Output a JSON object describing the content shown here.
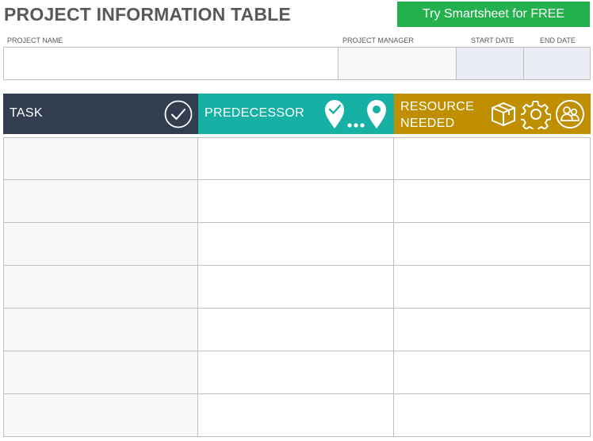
{
  "title": "PROJECT INFORMATION TABLE",
  "cta_label": "Try Smartsheet for FREE",
  "info": {
    "project_name_label": "PROJECT NAME",
    "project_manager_label": "PROJECT MANAGER",
    "start_date_label": "START DATE",
    "end_date_label": "END DATE",
    "project_name_value": "",
    "project_manager_value": "",
    "start_date_value": "",
    "end_date_value": ""
  },
  "columns": {
    "task": "TASK",
    "predecessor": "PREDECESSOR",
    "resource_line1": "RESOURCE",
    "resource_line2": "NEEDED"
  },
  "icons": {
    "task": "check-circle-icon",
    "predecessor": "map-pins-route-icon",
    "resource_box": "box-icon",
    "resource_gear": "gear-icon",
    "resource_people": "people-icon"
  },
  "colors": {
    "task_header": "#323e4f",
    "predecessor_header": "#17b0a4",
    "resource_header": "#bf8f00",
    "cta": "#22b14c"
  },
  "rows": [
    {
      "task": "",
      "predecessor": "",
      "resource": ""
    },
    {
      "task": "",
      "predecessor": "",
      "resource": ""
    },
    {
      "task": "",
      "predecessor": "",
      "resource": ""
    },
    {
      "task": "",
      "predecessor": "",
      "resource": ""
    },
    {
      "task": "",
      "predecessor": "",
      "resource": ""
    },
    {
      "task": "",
      "predecessor": "",
      "resource": ""
    },
    {
      "task": "",
      "predecessor": "",
      "resource": ""
    }
  ]
}
